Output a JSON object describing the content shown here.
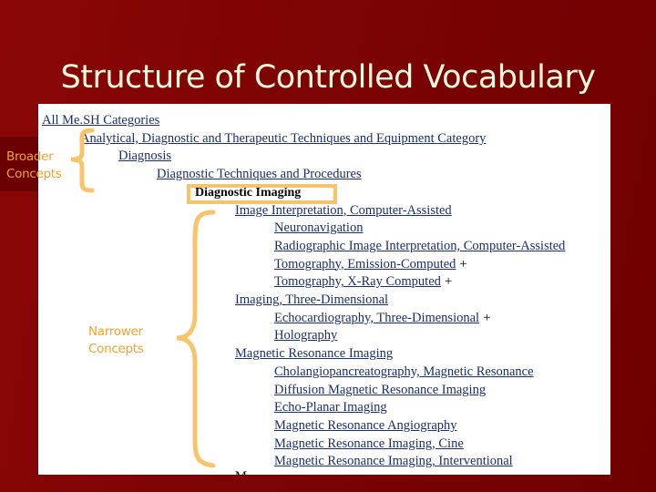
{
  "slide": {
    "title": "Structure of Controlled Vocabulary",
    "colors": {
      "background": "#7a0303",
      "title_text": "#fff8dc",
      "annotation": "#f2a22e",
      "brace": "#f8c46a",
      "link": "#1b2f6b"
    }
  },
  "annotations": {
    "broader": [
      "Broader",
      "Concepts"
    ],
    "narrower": [
      "Narrower",
      "Concepts"
    ]
  },
  "tree": {
    "ancestors": [
      {
        "label": "All Me.SH Categories",
        "level": 0
      },
      {
        "label": "Analytical, Diagnostic and Therapeutic Techniques and Equipment Category",
        "level": 1
      },
      {
        "label": "Diagnosis",
        "level": 2
      },
      {
        "label": "Diagnostic Techniques and Procedures",
        "level": 3
      }
    ],
    "current": {
      "label": "Diagnostic Imaging",
      "level": 4
    },
    "children": [
      {
        "label": "Image Interpretation, Computer-Assisted",
        "level": 5,
        "has_more": false
      },
      {
        "label": "Neuronavigation",
        "level": 6,
        "has_more": false
      },
      {
        "label": "Radiographic Image Interpretation, Computer-Assisted",
        "level": 6,
        "has_more": false
      },
      {
        "label": "Tomography, Emission-Computed",
        "level": 6,
        "has_more": true
      },
      {
        "label": "Tomography, X-Ray Computed",
        "level": 6,
        "has_more": true
      },
      {
        "label": "Imaging, Three-Dimensional",
        "level": 5,
        "has_more": false
      },
      {
        "label": "Echocardiography, Three-Dimensional",
        "level": 6,
        "has_more": true
      },
      {
        "label": "Holography",
        "level": 6,
        "has_more": false
      },
      {
        "label": "Magnetic Resonance Imaging",
        "level": 5,
        "has_more": false
      },
      {
        "label": "Cholangiopancreatography, Magnetic Resonance",
        "level": 6,
        "has_more": false
      },
      {
        "label": "Diffusion Magnetic Resonance Imaging",
        "level": 6,
        "has_more": false
      },
      {
        "label": "Echo-Planar Imaging",
        "level": 6,
        "has_more": false
      },
      {
        "label": "Magnetic Resonance Angiography",
        "level": 6,
        "has_more": false
      },
      {
        "label": "Magnetic Resonance Imaging, Cine",
        "level": 6,
        "has_more": false
      },
      {
        "label": "Magnetic Resonance Imaging, Interventional",
        "level": 6,
        "has_more": false
      }
    ],
    "plus_symbol": "+",
    "cut_off_text": "M"
  }
}
